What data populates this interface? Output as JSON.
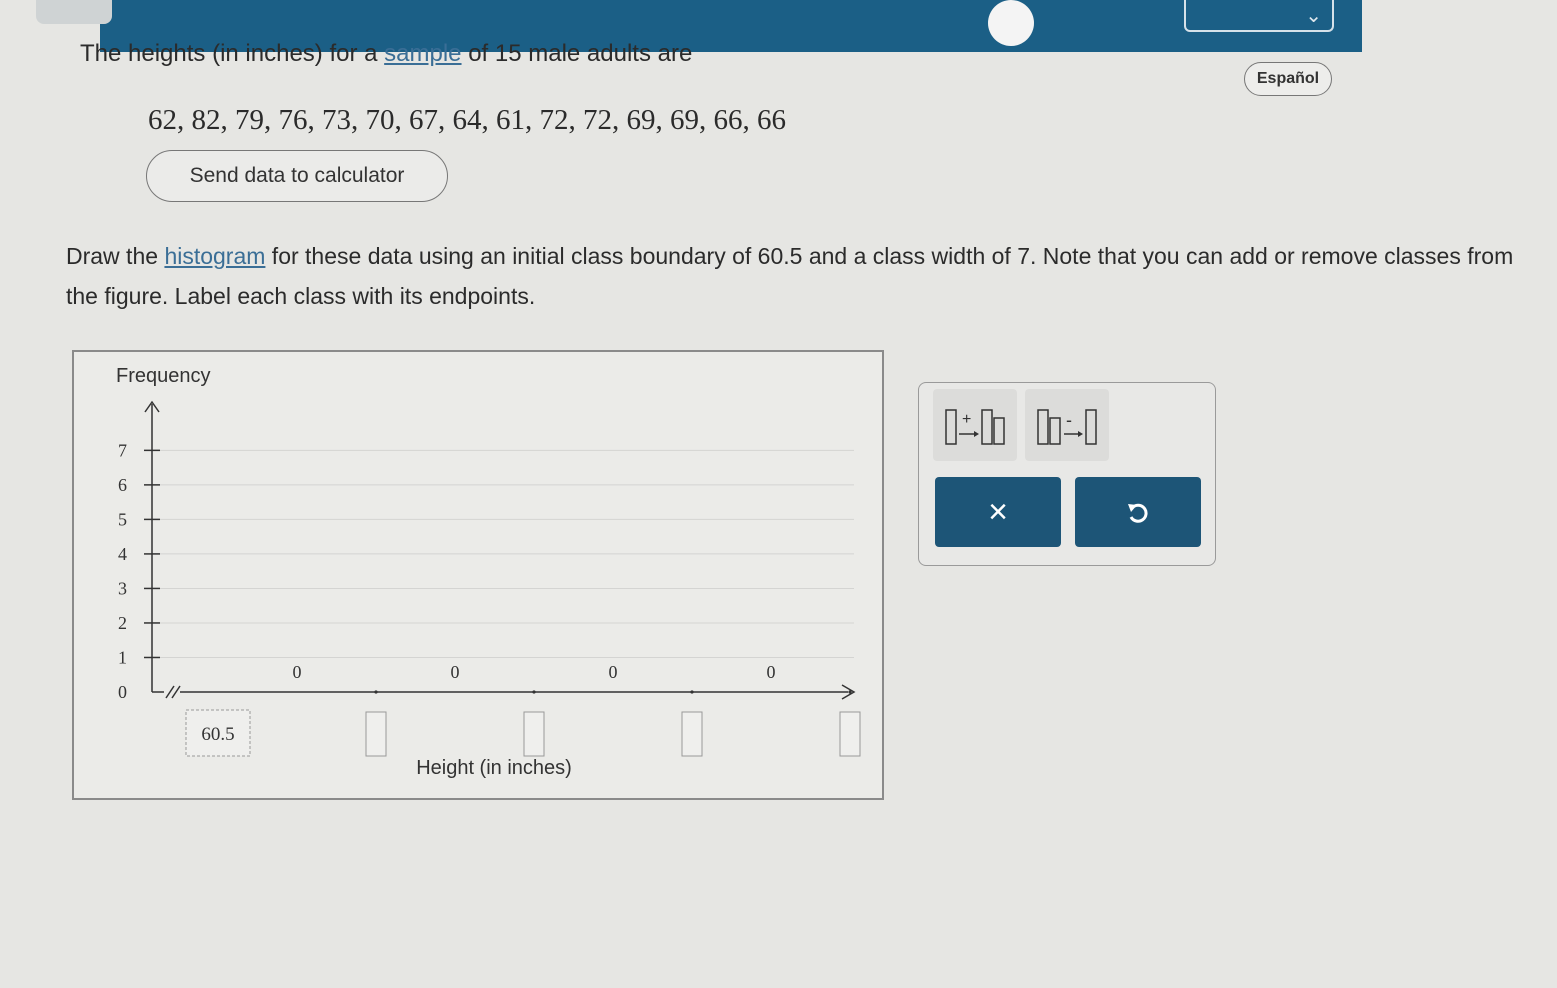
{
  "header": {
    "espanol_label": "Español"
  },
  "question": {
    "intro_prefix": "The heights (in inches) for a ",
    "intro_link": "sample",
    "intro_suffix": " of 15 male adults are",
    "data_values": "62, 82, 79, 76, 73, 70, 67, 64, 61, 72, 72, 69, 69, 66, 66",
    "send_button_label": "Send data to calculator",
    "instruction_prefix": "Draw the ",
    "instruction_link": "histogram",
    "instruction_suffix": " for these data using an initial class boundary of 60.5 and a class width of 7. Note that you can add or remove classes from the figure. Label each class with its endpoints."
  },
  "chart_data": {
    "type": "bar",
    "ylabel": "Frequency",
    "xlabel": "Height (in inches)",
    "y_ticks": [
      "0",
      "1",
      "2",
      "3",
      "4",
      "5",
      "6",
      "7"
    ],
    "ylim": [
      0,
      7
    ],
    "boundaries": [
      "60.5",
      "",
      "",
      "",
      ""
    ],
    "values": [
      0,
      0,
      0,
      0
    ],
    "value_labels": [
      "0",
      "0",
      "0",
      "0"
    ],
    "grid": true
  },
  "tools": {
    "remove_label": "×"
  }
}
